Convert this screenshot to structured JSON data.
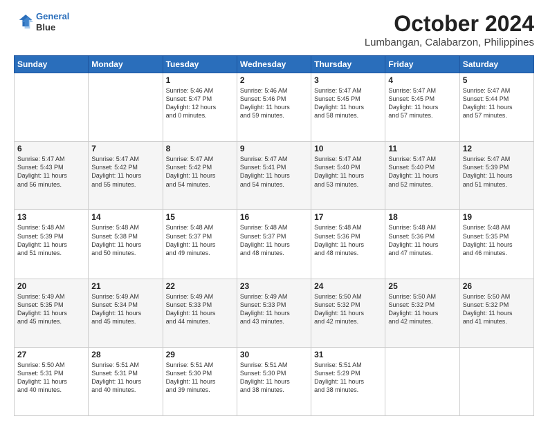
{
  "header": {
    "logo_line1": "General",
    "logo_line2": "Blue",
    "title": "October 2024",
    "subtitle": "Lumbangan, Calabarzon, Philippines"
  },
  "calendar": {
    "weekdays": [
      "Sunday",
      "Monday",
      "Tuesday",
      "Wednesday",
      "Thursday",
      "Friday",
      "Saturday"
    ],
    "weeks": [
      [
        {
          "day": "",
          "content": ""
        },
        {
          "day": "",
          "content": ""
        },
        {
          "day": "1",
          "content": "Sunrise: 5:46 AM\nSunset: 5:47 PM\nDaylight: 12 hours\nand 0 minutes."
        },
        {
          "day": "2",
          "content": "Sunrise: 5:46 AM\nSunset: 5:46 PM\nDaylight: 11 hours\nand 59 minutes."
        },
        {
          "day": "3",
          "content": "Sunrise: 5:47 AM\nSunset: 5:45 PM\nDaylight: 11 hours\nand 58 minutes."
        },
        {
          "day": "4",
          "content": "Sunrise: 5:47 AM\nSunset: 5:45 PM\nDaylight: 11 hours\nand 57 minutes."
        },
        {
          "day": "5",
          "content": "Sunrise: 5:47 AM\nSunset: 5:44 PM\nDaylight: 11 hours\nand 57 minutes."
        }
      ],
      [
        {
          "day": "6",
          "content": "Sunrise: 5:47 AM\nSunset: 5:43 PM\nDaylight: 11 hours\nand 56 minutes."
        },
        {
          "day": "7",
          "content": "Sunrise: 5:47 AM\nSunset: 5:42 PM\nDaylight: 11 hours\nand 55 minutes."
        },
        {
          "day": "8",
          "content": "Sunrise: 5:47 AM\nSunset: 5:42 PM\nDaylight: 11 hours\nand 54 minutes."
        },
        {
          "day": "9",
          "content": "Sunrise: 5:47 AM\nSunset: 5:41 PM\nDaylight: 11 hours\nand 54 minutes."
        },
        {
          "day": "10",
          "content": "Sunrise: 5:47 AM\nSunset: 5:40 PM\nDaylight: 11 hours\nand 53 minutes."
        },
        {
          "day": "11",
          "content": "Sunrise: 5:47 AM\nSunset: 5:40 PM\nDaylight: 11 hours\nand 52 minutes."
        },
        {
          "day": "12",
          "content": "Sunrise: 5:47 AM\nSunset: 5:39 PM\nDaylight: 11 hours\nand 51 minutes."
        }
      ],
      [
        {
          "day": "13",
          "content": "Sunrise: 5:48 AM\nSunset: 5:39 PM\nDaylight: 11 hours\nand 51 minutes."
        },
        {
          "day": "14",
          "content": "Sunrise: 5:48 AM\nSunset: 5:38 PM\nDaylight: 11 hours\nand 50 minutes."
        },
        {
          "day": "15",
          "content": "Sunrise: 5:48 AM\nSunset: 5:37 PM\nDaylight: 11 hours\nand 49 minutes."
        },
        {
          "day": "16",
          "content": "Sunrise: 5:48 AM\nSunset: 5:37 PM\nDaylight: 11 hours\nand 48 minutes."
        },
        {
          "day": "17",
          "content": "Sunrise: 5:48 AM\nSunset: 5:36 PM\nDaylight: 11 hours\nand 48 minutes."
        },
        {
          "day": "18",
          "content": "Sunrise: 5:48 AM\nSunset: 5:36 PM\nDaylight: 11 hours\nand 47 minutes."
        },
        {
          "day": "19",
          "content": "Sunrise: 5:48 AM\nSunset: 5:35 PM\nDaylight: 11 hours\nand 46 minutes."
        }
      ],
      [
        {
          "day": "20",
          "content": "Sunrise: 5:49 AM\nSunset: 5:35 PM\nDaylight: 11 hours\nand 45 minutes."
        },
        {
          "day": "21",
          "content": "Sunrise: 5:49 AM\nSunset: 5:34 PM\nDaylight: 11 hours\nand 45 minutes."
        },
        {
          "day": "22",
          "content": "Sunrise: 5:49 AM\nSunset: 5:33 PM\nDaylight: 11 hours\nand 44 minutes."
        },
        {
          "day": "23",
          "content": "Sunrise: 5:49 AM\nSunset: 5:33 PM\nDaylight: 11 hours\nand 43 minutes."
        },
        {
          "day": "24",
          "content": "Sunrise: 5:50 AM\nSunset: 5:32 PM\nDaylight: 11 hours\nand 42 minutes."
        },
        {
          "day": "25",
          "content": "Sunrise: 5:50 AM\nSunset: 5:32 PM\nDaylight: 11 hours\nand 42 minutes."
        },
        {
          "day": "26",
          "content": "Sunrise: 5:50 AM\nSunset: 5:32 PM\nDaylight: 11 hours\nand 41 minutes."
        }
      ],
      [
        {
          "day": "27",
          "content": "Sunrise: 5:50 AM\nSunset: 5:31 PM\nDaylight: 11 hours\nand 40 minutes."
        },
        {
          "day": "28",
          "content": "Sunrise: 5:51 AM\nSunset: 5:31 PM\nDaylight: 11 hours\nand 40 minutes."
        },
        {
          "day": "29",
          "content": "Sunrise: 5:51 AM\nSunset: 5:30 PM\nDaylight: 11 hours\nand 39 minutes."
        },
        {
          "day": "30",
          "content": "Sunrise: 5:51 AM\nSunset: 5:30 PM\nDaylight: 11 hours\nand 38 minutes."
        },
        {
          "day": "31",
          "content": "Sunrise: 5:51 AM\nSunset: 5:29 PM\nDaylight: 11 hours\nand 38 minutes."
        },
        {
          "day": "",
          "content": ""
        },
        {
          "day": "",
          "content": ""
        }
      ]
    ]
  }
}
